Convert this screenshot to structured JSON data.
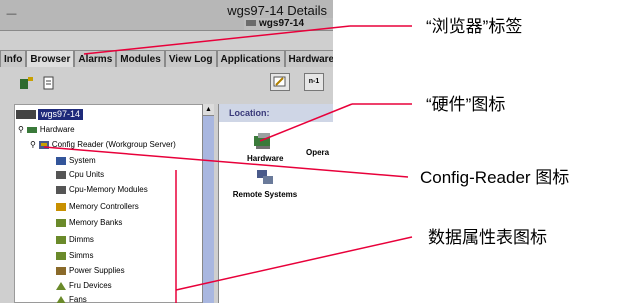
{
  "window": {
    "title": "wgs97-14 Details",
    "host_label": "wgs97-14",
    "title_icon": "minus-icon"
  },
  "tabs": [
    "Info",
    "Browser",
    "Alarms",
    "Modules",
    "View Log",
    "Applications",
    "Hardware"
  ],
  "active_tab": "Browser",
  "toolbar": {
    "right_button_2": "n-1"
  },
  "tree": {
    "host": "wgs97-14",
    "hardware": "Hardware",
    "config_reader": "Config Reader (Workgroup Server)",
    "items": [
      "System",
      "Cpu Units",
      "Cpu-Memory Modules",
      "Memory Controllers",
      "Memory Banks",
      "Dimms",
      "Simms",
      "Power Supplies",
      "Fru Devices",
      "Fans"
    ]
  },
  "right_panel": {
    "location_label": "Location:",
    "icon_hardware": "Hardware",
    "icon_operating": "Opera",
    "icon_remote": "Remote Systems"
  },
  "annotations": {
    "browser_tab": "“浏览器”标签",
    "hardware_icon": "“硬件”图标",
    "config_reader_icon": "Config-Reader 图标",
    "data_property_icon": "数据属性表图标"
  },
  "colors": {
    "window_bg": "#cfcfcf",
    "selection": "#1e2a7a",
    "scrollbar": "#a9b7e0",
    "callout_line": "#e8003a"
  }
}
